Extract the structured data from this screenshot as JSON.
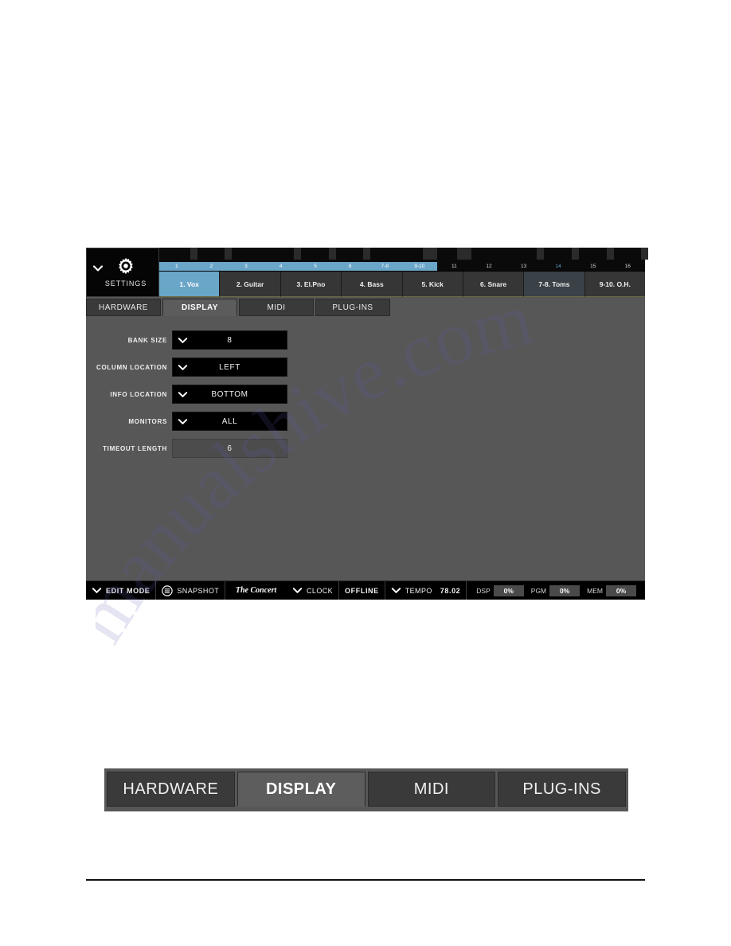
{
  "device": {
    "settings_panel": {
      "label": "SETTINGS",
      "chevron_icon": "chevron-down-icon",
      "gear_icon": "gear-icon"
    },
    "channel_numbers": [
      {
        "num": "1",
        "selected": true,
        "accent": false
      },
      {
        "num": "2",
        "selected": true,
        "accent": false
      },
      {
        "num": "3",
        "selected": true,
        "accent": false
      },
      {
        "num": "4",
        "selected": true,
        "accent": false
      },
      {
        "num": "5",
        "selected": true,
        "accent": false
      },
      {
        "num": "6",
        "selected": true,
        "accent": false
      },
      {
        "num": "7-8",
        "selected": true,
        "accent": false
      },
      {
        "num": "9-10",
        "selected": true,
        "accent": false
      },
      {
        "num": "11",
        "selected": false,
        "accent": false
      },
      {
        "num": "12",
        "selected": false,
        "accent": false
      },
      {
        "num": "13",
        "selected": false,
        "accent": false
      },
      {
        "num": "14",
        "selected": false,
        "accent": true
      },
      {
        "num": "15",
        "selected": false,
        "accent": false
      },
      {
        "num": "16",
        "selected": false,
        "accent": false
      }
    ],
    "channels": [
      {
        "label": "1. Vox",
        "state": "active"
      },
      {
        "label": "2. Guitar",
        "state": "normal"
      },
      {
        "label": "3. El.Pno",
        "state": "normal"
      },
      {
        "label": "4. Bass",
        "state": "normal"
      },
      {
        "label": "5. Kick",
        "state": "normal"
      },
      {
        "label": "6. Snare",
        "state": "normal"
      },
      {
        "label": "7-8. Toms",
        "state": "tint"
      },
      {
        "label": "9-10. O.H.",
        "state": "normal"
      }
    ],
    "tabs": [
      {
        "label": "HARDWARE",
        "active": false
      },
      {
        "label": "DISPLAY",
        "active": true
      },
      {
        "label": "MIDI",
        "active": false
      },
      {
        "label": "PLUG-INS",
        "active": false
      }
    ],
    "display_settings": [
      {
        "label": "BANK SIZE",
        "value": "8",
        "type": "dropdown"
      },
      {
        "label": "COLUMN LOCATION",
        "value": "LEFT",
        "type": "dropdown"
      },
      {
        "label": "INFO LOCATION",
        "value": "BOTTOM",
        "type": "dropdown"
      },
      {
        "label": "MONITORS",
        "value": "ALL",
        "type": "dropdown"
      },
      {
        "label": "TIMEOUT LENGTH",
        "value": "6",
        "type": "stepper"
      }
    ],
    "status_bar": {
      "edit_mode_label": "EDIT MODE",
      "edit_mode_chevron_icon": "chevron-down-icon",
      "snapshot_label": "SNAPSHOT",
      "snapshot_icon": "list-circle-icon",
      "concert_name": "The Concert",
      "clock_label": "CLOCK",
      "clock_chevron_icon": "chevron-down-icon",
      "clock_status": "OFFLINE",
      "tempo_label": "TEMPO",
      "tempo_chevron_icon": "chevron-down-icon",
      "tempo_value": "78.02",
      "meters": [
        {
          "name": "DSP",
          "value": "0%"
        },
        {
          "name": "PGM",
          "value": "0%"
        },
        {
          "name": "MEM",
          "value": "0%"
        }
      ]
    }
  },
  "figure_tabs": [
    {
      "label": "HARDWARE",
      "active": false
    },
    {
      "label": "DISPLAY",
      "active": true
    },
    {
      "label": "MIDI",
      "active": false
    },
    {
      "label": "PLUG-INS",
      "active": false
    }
  ],
  "watermark": {
    "text": "manualshive.com"
  },
  "colors": {
    "accent_blue": "#6aa6c8",
    "panel_gray": "#575757",
    "field_black": "#000000",
    "tab_gray": "#3a3a3a",
    "tab_active_gray": "#5c5c5c"
  }
}
